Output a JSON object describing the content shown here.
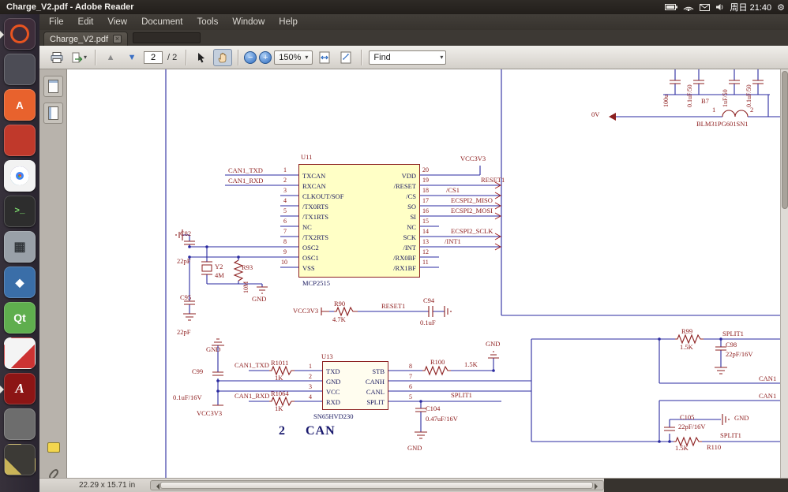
{
  "colors": {
    "wire": "#2a2aa0",
    "component": "#8c2020",
    "net_label": "#8c1a1a",
    "chip_fill": "#ffffc6",
    "pin_text": "#17175e",
    "toolbar_bg": "#d6d2cd",
    "panel_bg": "#221e1b"
  },
  "titlebar": {
    "title": "Charge_V2.pdf - Adobe Reader",
    "clock": "周日 21:40"
  },
  "menubar": {
    "items": [
      {
        "label": "File"
      },
      {
        "label": "Edit"
      },
      {
        "label": "View"
      },
      {
        "label": "Document"
      },
      {
        "label": "Tools"
      },
      {
        "label": "Window"
      },
      {
        "label": "Help"
      }
    ]
  },
  "tabbar": {
    "tab_label": "Charge_V2.pdf"
  },
  "toolbar": {
    "page_value": "2",
    "page_total": "/ 2",
    "zoom_value": "150%",
    "find_value": "Find"
  },
  "ui": {
    "caret": "▾",
    "close": "×",
    "plus": "+",
    "minus": "−",
    "up": "▲",
    "down": "▼",
    "gear": "⚙"
  },
  "launcher": {
    "items": [
      {
        "name": "dash-home",
        "glyph": ""
      },
      {
        "name": "file-manager",
        "glyph": ""
      },
      {
        "name": "word-processor",
        "glyph": "A"
      },
      {
        "name": "system-settings",
        "glyph": ""
      },
      {
        "name": "chrome-browser",
        "glyph": ""
      },
      {
        "name": "terminal",
        "glyph": ">_"
      },
      {
        "name": "calculator",
        "glyph": "▦"
      },
      {
        "name": "graphics-tool",
        "glyph": "◆"
      },
      {
        "name": "qt-creator",
        "glyph": "Qt"
      },
      {
        "name": "paint-tool",
        "glyph": ""
      },
      {
        "name": "adobe-reader",
        "glyph": "A"
      },
      {
        "name": "screenshot-tool",
        "glyph": ""
      },
      {
        "name": "notes-app",
        "glyph": ""
      }
    ]
  },
  "statusbar": {
    "doc_size": "22.29 x 15.71 in"
  },
  "schematic": {
    "sheet": {
      "number": "2",
      "title": "CAN"
    },
    "u11": {
      "ref": "U11",
      "part": "MCP2515",
      "left": [
        {
          "n": "1",
          "name": "TXCAN"
        },
        {
          "n": "2",
          "name": "RXCAN"
        },
        {
          "n": "3",
          "name": "CLKOUT/SOF"
        },
        {
          "n": "4",
          "name": "/TX0RTS"
        },
        {
          "n": "5",
          "name": "/TX1RTS"
        },
        {
          "n": "6",
          "name": "NC"
        },
        {
          "n": "7",
          "name": "/TX2RTS"
        },
        {
          "n": "8",
          "name": "OSC2"
        },
        {
          "n": "9",
          "name": "OSC1"
        },
        {
          "n": "10",
          "name": "VSS"
        }
      ],
      "right": [
        {
          "n": "20",
          "name": "VDD"
        },
        {
          "n": "19",
          "name": "/RESET"
        },
        {
          "n": "18",
          "name": "/CS"
        },
        {
          "n": "17",
          "name": "SO"
        },
        {
          "n": "16",
          "name": "SI"
        },
        {
          "n": "15",
          "name": "NC"
        },
        {
          "n": "14",
          "name": "SCK"
        },
        {
          "n": "13",
          "name": "/INT"
        },
        {
          "n": "12",
          "name": "/RX0BF"
        },
        {
          "n": "11",
          "name": "/RX1BF"
        }
      ]
    },
    "u13": {
      "ref": "U13",
      "part": "SN65HVD230",
      "left": [
        {
          "n": "1",
          "name": "TXD"
        },
        {
          "n": "2",
          "name": "GND"
        },
        {
          "n": "3",
          "name": "VCC"
        },
        {
          "n": "4",
          "name": "RXD"
        }
      ],
      "right": [
        {
          "n": "8",
          "name": "STB"
        },
        {
          "n": "7",
          "name": "CANH"
        },
        {
          "n": "6",
          "name": "CANL"
        },
        {
          "n": "5",
          "name": "SPLIT"
        }
      ]
    },
    "labels": {
      "can1_txd_a": "CAN1_TXD",
      "can1_rxd_a": "CAN1_RXD",
      "vcc3v3_a": "VCC3V3",
      "reset1_a": "RESET1",
      "cs1": "/CS1",
      "ecspi2_miso": "ECSPI2_MISO",
      "ecspi2_mosi": "ECSPI2_MOSI",
      "ecspi2_sclk": "ECSPI2_SCLK",
      "int1": "/INT1",
      "c82": "C82",
      "c82_v": "22pF",
      "c95": "C95",
      "c95_v": "22pF",
      "y2": "Y2",
      "y2_v": "4M",
      "r93": "R93",
      "r93_v": "10M",
      "gnd_a": "GND",
      "vcc3v3_b": "VCC3V3",
      "r90": "R90",
      "r90_v": "4.7K",
      "reset1_b": "RESET1",
      "c94": "C94",
      "c94_v": "0.1uF",
      "gnd_b": "GND",
      "c99": "C99",
      "c99_v": "0.1uF/16V",
      "vcc3v3_c": "VCC3V3",
      "can1_txd_b": "CAN1_TXD",
      "r1011": "R1011",
      "r1011_v": "1K",
      "can1_rxd_b": "CAN1_RXD",
      "r1064": "R1064",
      "r1064_v": "1K",
      "r100": "R100",
      "r100_v": "1.5K",
      "gnd_c": "GND",
      "split1_a": "SPLIT1",
      "c104": "C104",
      "c104_v": "0.47uF/16V",
      "gnd_d": "GND",
      "r99": "R99",
      "r99_v": "1.5K",
      "split1_b": "SPLIT1",
      "c98": "C98",
      "c98_v": "22pF/16V",
      "can1_a": "CAN1",
      "can1_b": "CAN1",
      "c105": "C105",
      "c105_v": "22pF/16V",
      "gnd_e": "GND",
      "split1_c": "SPLIT1",
      "r110": "R110",
      "r110_v": "1.5K",
      "b7": "B7",
      "b7_v": "BLM31PG601SN1",
      "b7_p1": "1",
      "b7_p2": "2",
      "zero_v": "0V",
      "cap1_v": "100u",
      "cap2_v": "0.1uF/50",
      "cap3_v": "1uF/50",
      "cap4_v": "0.1uF/50"
    }
  }
}
